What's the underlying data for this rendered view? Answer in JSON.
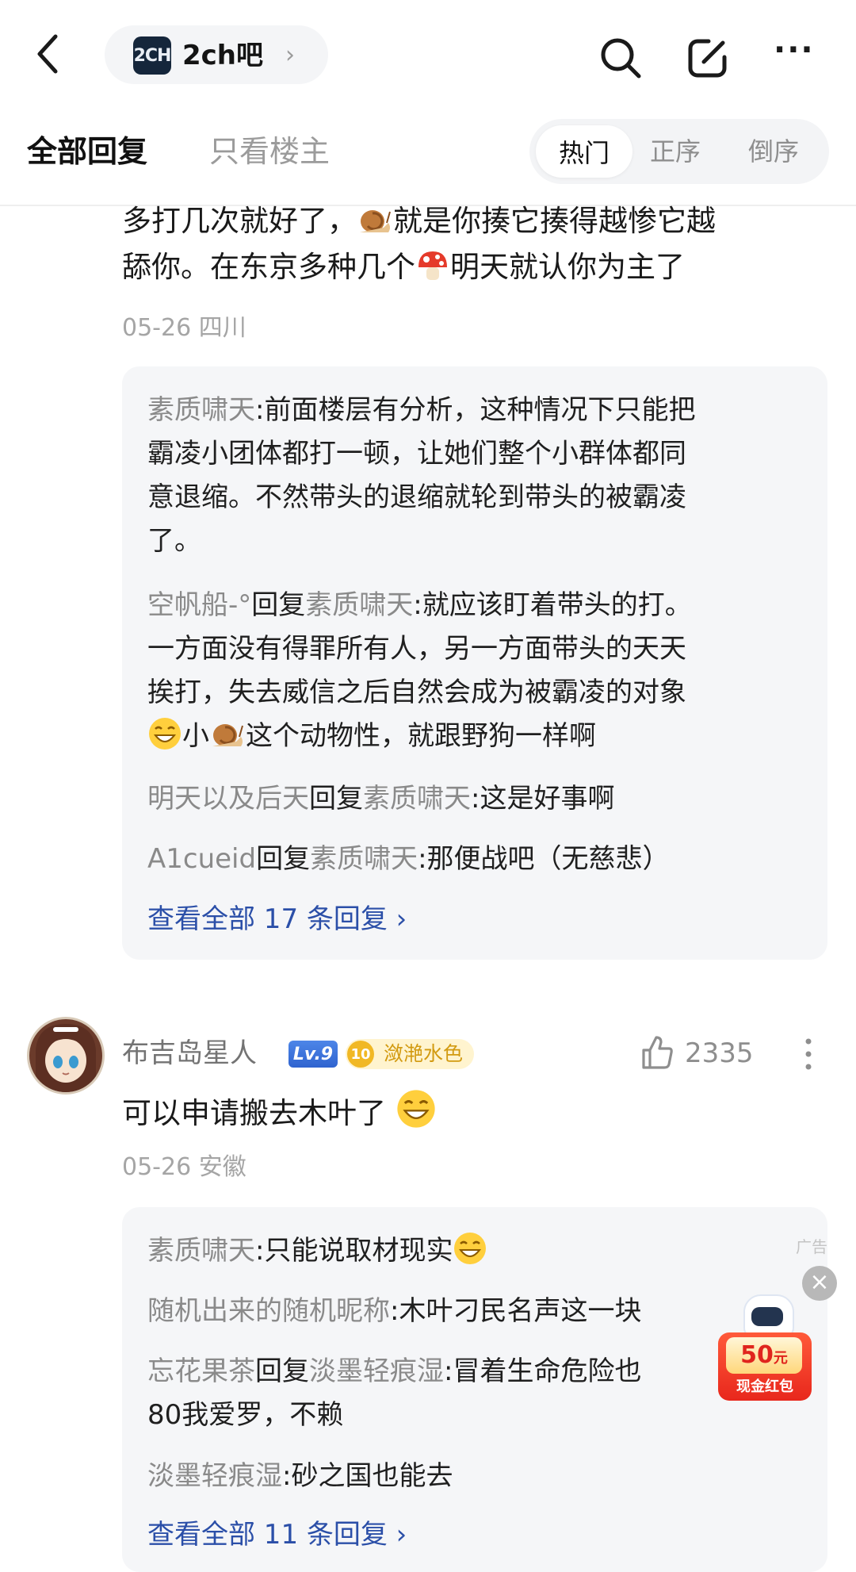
{
  "topbar": {
    "forum_logo": "2CH",
    "forum_name": "2ch吧",
    "chevron": "›",
    "more": "···"
  },
  "tabs": {
    "all_replies": "全部回复",
    "op_only": "只看楼主",
    "sort_hot": "热门",
    "sort_asc": "正序",
    "sort_desc": "倒序"
  },
  "comment1": {
    "text_part1": "多打几次就好了，",
    "text_part2": "就是你揍它揍得越惨它越",
    "text_part3": "舔你。在东京多种几个",
    "text_part4": "明天就认你为主了",
    "date": "05-26",
    "location": "四川",
    "replies": {
      "r1_user": "素质啸天",
      "r1_text": ":前面楼层有分析，这种情况下只能把",
      "r1_line2": "霸凌小团体都打一顿，让她们整个小群体都同",
      "r1_line3": "意退缩。不然带头的退缩就轮到带头的被霸凌",
      "r1_line4": "了。",
      "r2_user": "空帆船-°",
      "r2_reply_word": "回复",
      "r2_target": "素质啸天",
      "r2_text": ":就应该盯着带头的打。",
      "r2_line2": "一方面没有得罪所有人，另一方面带头的天天",
      "r2_line3": "挨打，失去威信之后自然会成为被霸凌的对象",
      "r2_line4a": "小",
      "r2_line4b": "这个动物性，就跟野狗一样啊",
      "r3_user": "明天以及后天",
      "r3_reply_word": "回复",
      "r3_target": "素质啸天",
      "r3_text": ":这是好事啊",
      "r4_user": "A1cueid",
      "r4_reply_word": "回复",
      "r4_target": "素质啸天",
      "r4_text": ":那便战吧（无慈悲）",
      "view_all": "查看全部 17 条回复 ›"
    }
  },
  "comment2": {
    "username": "布吉岛星人",
    "level": "Lv.9",
    "rank_num": "10",
    "rank_title": "潋滟水色",
    "likes": "2335",
    "text": "可以申请搬去木叶了",
    "date": "05-26",
    "location": "安徽",
    "replies": {
      "r1_user": "素质啸天",
      "r1_text": ":只能说取材现实",
      "r2_user": "随机出来的随机昵称",
      "r2_text": ":木叶刁民名声这一块",
      "r3_user": "忘花果茶",
      "r3_reply_word": "回复",
      "r3_target": "淡墨轻痕湿",
      "r3_text": ":冒着生命危险也",
      "r3_line2": "80我爱罗，不赖",
      "r4_user": "淡墨轻痕湿",
      "r4_text": ":砂之国也能去",
      "view_all": "查看全部 11 条回复 ›"
    }
  },
  "ad": {
    "label": "广告",
    "close": "×",
    "amount": "50",
    "unit": "元",
    "subtitle": "现金红包"
  },
  "icons": [
    "back-arrow-icon",
    "search-icon",
    "edit-icon",
    "more-icon",
    "snail-emoji-icon",
    "mushroom-emoji-icon",
    "grin-emoji-icon",
    "like-icon",
    "more-vertical-icon",
    "close-icon",
    "robot-icon"
  ],
  "colors": {
    "link": "#2b4fa8",
    "username_gray": "#8a8a8a",
    "reply_bg": "#f5f6f8",
    "level_blue": "#2f64cf",
    "rank_gold": "#f1b824"
  }
}
